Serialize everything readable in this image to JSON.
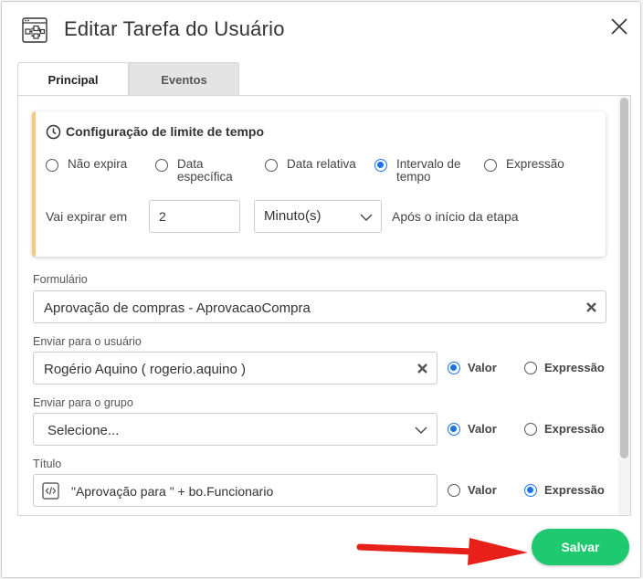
{
  "dialog": {
    "title": "Editar Tarefa do Usuário",
    "tabs": [
      {
        "label": "Principal",
        "active": true
      },
      {
        "label": "Eventos",
        "active": false
      }
    ]
  },
  "time_limit": {
    "title": "Configuração de limite de tempo",
    "options": [
      {
        "label_line1": "Não expira",
        "label_line2": "",
        "selected": false
      },
      {
        "label_line1": "Data",
        "label_line2": "específica",
        "selected": false
      },
      {
        "label_line1": "Data relativa",
        "label_line2": "",
        "selected": false
      },
      {
        "label_line1": "Intervalo de",
        "label_line2": "tempo",
        "selected": true
      },
      {
        "label_line1": "Expressão",
        "label_line2": "",
        "selected": false
      }
    ],
    "expire_label": "Vai expirar em",
    "expire_value": "2",
    "unit_value": "Minuto(s)",
    "after_label": "Após o início da etapa"
  },
  "form_field": {
    "label": "Formulário",
    "value": "Aprovação de compras - AprovacaoCompra"
  },
  "user_field": {
    "label": "Enviar para o usuário",
    "value": "Rogério Aquino ( rogerio.aquino )",
    "mode_value_label": "Valor",
    "mode_expr_label": "Expressão",
    "mode": "Valor"
  },
  "group_field": {
    "label": "Enviar para o grupo",
    "placeholder": "Selecione...",
    "mode_value_label": "Valor",
    "mode_expr_label": "Expressão",
    "mode": "Valor"
  },
  "title_field": {
    "label": "Título",
    "value": "\"Aprovação para \" + bo.Funcionario",
    "mode_value_label": "Valor",
    "mode_expr_label": "Expressão",
    "mode": "Expressão"
  },
  "footer": {
    "save_label": "Salvar"
  },
  "colors": {
    "accent_blue": "#1a73e8",
    "save_green": "#1ec96f",
    "card_accent": "#f6c978",
    "annotation_red": "#e8201a"
  }
}
